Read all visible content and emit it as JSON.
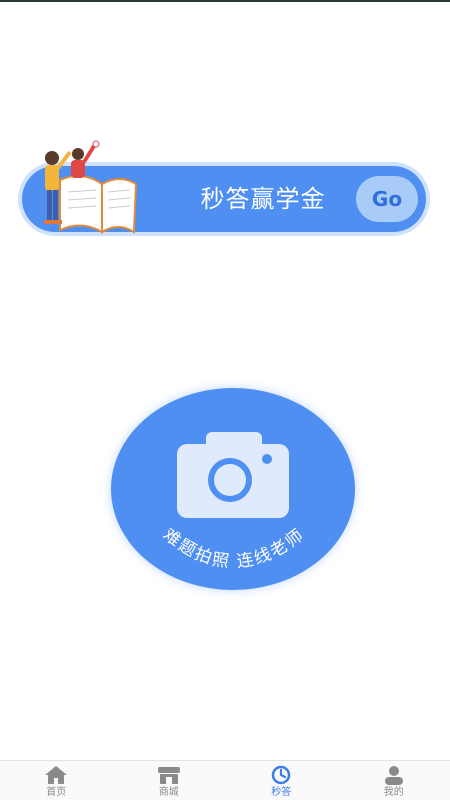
{
  "banner": {
    "title": "秒答赢学金",
    "go_label": "Go"
  },
  "camera": {
    "caption": "难题拍照  连线老师"
  },
  "bottom_nav": {
    "items": [
      {
        "label": "首页",
        "icon": "home-icon",
        "active": false
      },
      {
        "label": "商城",
        "icon": "shop-icon",
        "active": false
      },
      {
        "label": "秒答",
        "icon": "clock-icon",
        "active": true
      },
      {
        "label": "我的",
        "icon": "profile-icon",
        "active": false
      }
    ]
  },
  "colors": {
    "primary_blue": "#4f8ff2",
    "active_nav": "#3a7de8",
    "inactive_nav": "#8a8a8a"
  }
}
